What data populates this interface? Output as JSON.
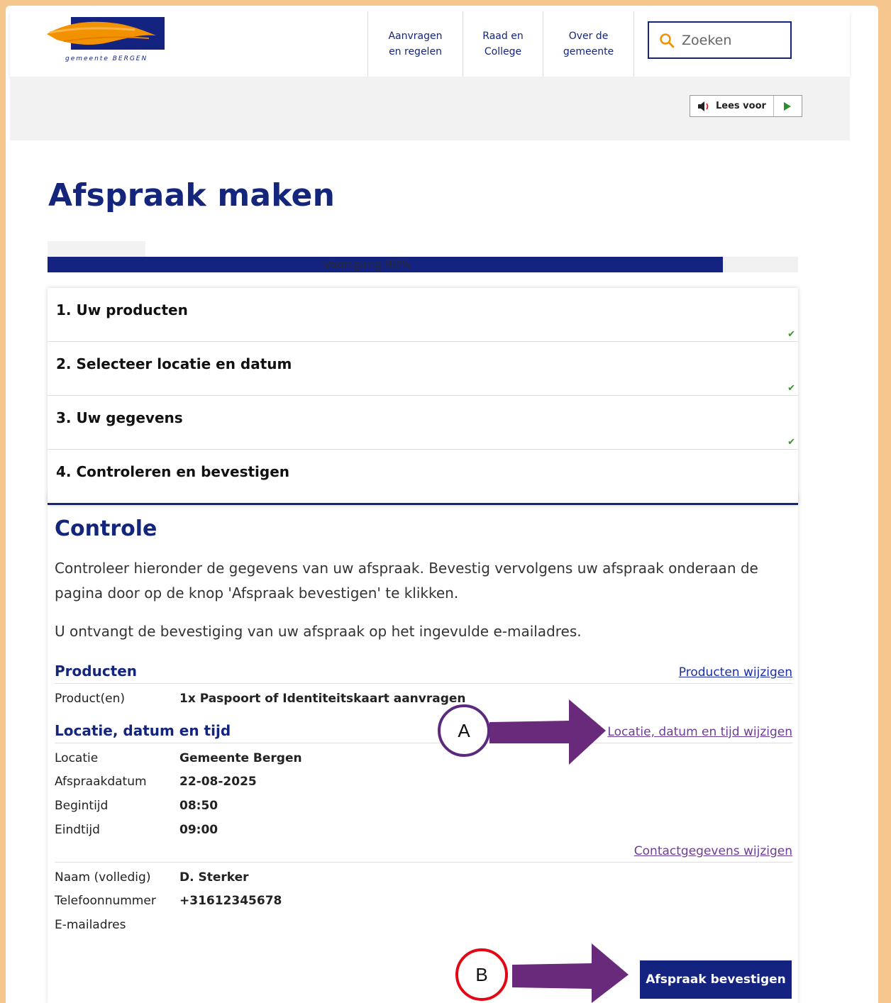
{
  "header": {
    "logo_text": "gemeente BERGEN",
    "nav": [
      {
        "line1": "Aanvragen",
        "line2": "en regelen"
      },
      {
        "line1": "Raad en",
        "line2": "College"
      },
      {
        "line1": "Over de",
        "line2": "gemeente"
      }
    ],
    "search_placeholder": "Zoeken"
  },
  "readspeaker": {
    "label": "Lees voor"
  },
  "page": {
    "title": "Afspraak maken",
    "progress_text": "Voortgang 90%",
    "progress_value": 0.9
  },
  "steps": [
    {
      "label": "1. Uw producten",
      "done": true
    },
    {
      "label": "2. Selecteer locatie en datum",
      "done": true
    },
    {
      "label": "3. Uw gegevens",
      "done": true
    },
    {
      "label": "4. Controleren en bevestigen",
      "done": false
    }
  ],
  "controle": {
    "title": "Controle",
    "intro": "Controleer hieronder de gegevens van uw afspraak. Bevestig vervolgens uw afspraak onderaan de pagina door op de knop 'Afspraak bevestigen' te klikken.",
    "intro2": "U ontvangt de bevestiging van uw afspraak op het ingevulde e-mailadres.",
    "producten": {
      "title": "Producten",
      "edit": "Producten wijzigen",
      "rows": [
        {
          "k": "Product(en)",
          "v": "1x Paspoort of Identiteitskaart aanvragen"
        }
      ]
    },
    "locatie": {
      "title": "Locatie, datum en tijd",
      "edit": "Locatie, datum en tijd wijzigen",
      "rows": [
        {
          "k": "Locatie",
          "v": "Gemeente Bergen"
        },
        {
          "k": "Afspraakdatum",
          "v": "22-08-2025"
        },
        {
          "k": "Begintijd",
          "v": "08:50"
        },
        {
          "k": "Eindtijd",
          "v": "09:00"
        }
      ]
    },
    "contact": {
      "edit": "Contactgegevens wijzigen",
      "rows": [
        {
          "k": "Naam (volledig)",
          "v": "D. Sterker"
        },
        {
          "k": "Telefoonnummer",
          "v": "+31612345678"
        },
        {
          "k": "E-mailadres",
          "v": ""
        }
      ]
    },
    "confirm_label": "Afspraak bevestigen"
  },
  "annotations": {
    "a_label": "A",
    "b_label": "B",
    "a_color": "#5b2a7e",
    "b_color": "#e30613",
    "arrow_color": "#6a2a7c"
  }
}
